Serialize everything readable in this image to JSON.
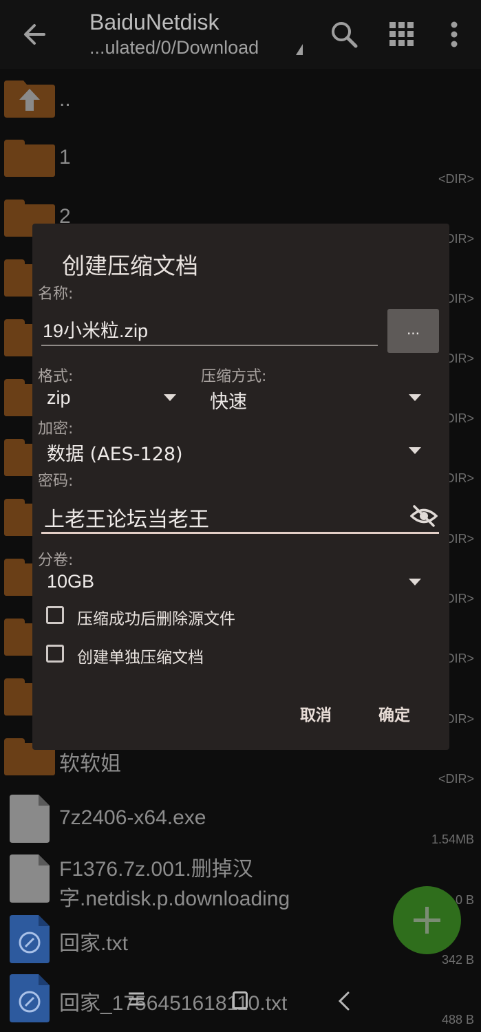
{
  "appbar": {
    "title": "BaiduNetdisk",
    "path": "...ulated/0/Download",
    "icons": [
      "back-arrow-icon",
      "search-icon",
      "grid-view-icon",
      "more-vert-icon"
    ]
  },
  "file_list": {
    "parent": "..",
    "folders": [
      {
        "name": "1",
        "meta": "<DIR>"
      },
      {
        "name": "2",
        "meta": "<DIR>"
      },
      {
        "name": "",
        "meta": "<DIR>"
      },
      {
        "name": "",
        "meta": "<DIR>"
      },
      {
        "name": "",
        "meta": "<DIR>"
      },
      {
        "name": "",
        "meta": "<DIR>"
      },
      {
        "name": "",
        "meta": "<DIR>"
      },
      {
        "name": "",
        "meta": "<DIR>"
      },
      {
        "name": "",
        "meta": "<DIR>"
      },
      {
        "name": "",
        "meta": "<DIR>"
      },
      {
        "name": "软软姐",
        "meta": "<DIR>"
      }
    ],
    "files": [
      {
        "name": "7z2406-x64.exe",
        "meta": "1.54MB"
      },
      {
        "name_line1": "F1376.7z.001.删掉汉",
        "name_line2": "字.netdisk.p.downloading",
        "meta": "0 B"
      },
      {
        "name": "回家.txt",
        "meta": "342 B"
      },
      {
        "name": "回家_1756451618110.txt",
        "meta": "488 B"
      }
    ]
  },
  "dialog": {
    "title": "创建压缩文档",
    "name_label": "名称:",
    "name_value": "19小米粒.zip",
    "browse_label": "...",
    "format_label": "格式:",
    "format_value": "zip",
    "method_label": "压缩方式:",
    "method_value": "快速",
    "encrypt_label": "加密:",
    "encrypt_value": "数据 (AES-128)",
    "password_label": "密码:",
    "password_value": "上老王论坛当老王",
    "volume_label": "分卷:",
    "volume_value": "10GB",
    "delete_source_label": "压缩成功后删除源文件",
    "delete_source_checked": false,
    "separate_archive_label": "创建单独压缩文档",
    "separate_archive_checked": false,
    "cancel_label": "取消",
    "ok_label": "确定"
  },
  "fab": {
    "icon": "plus-icon"
  },
  "colors": {
    "folder": "#6a3f17",
    "dialog_bg": "#262221",
    "fab": "#2f6e1c",
    "accent_underline": "#e3cfc7"
  }
}
